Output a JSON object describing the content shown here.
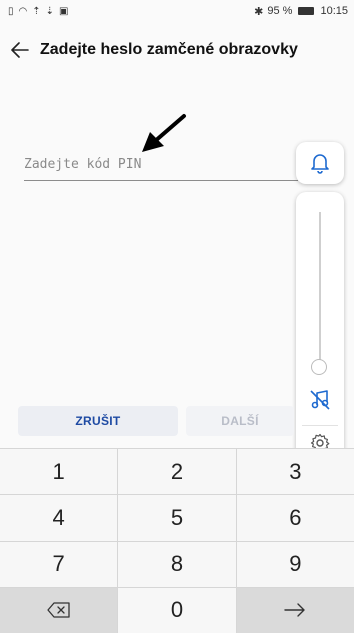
{
  "status_bar": {
    "bluetooth": "✱",
    "battery_percent": "95 %",
    "time": "10:15"
  },
  "header": {
    "title": "Zadejte heslo zamčené obrazovky",
    "back_icon": "arrow-left-icon"
  },
  "pin_field": {
    "placeholder": "Zadejte kód PIN",
    "value": ""
  },
  "buttons": {
    "cancel": "ZRUŠIT",
    "next": "DALŠÍ"
  },
  "keypad": {
    "keys": [
      "1",
      "2",
      "3",
      "4",
      "5",
      "6",
      "7",
      "8",
      "9",
      "0"
    ]
  },
  "volume_panel": {
    "level": 0,
    "icons": [
      "bell-icon",
      "mute-note-icon",
      "settings-gear-icon"
    ]
  },
  "colors": {
    "accent": "#1e4aa3",
    "disabled": "#b9bdc8",
    "keypad_bg": "#f7f7f7"
  }
}
